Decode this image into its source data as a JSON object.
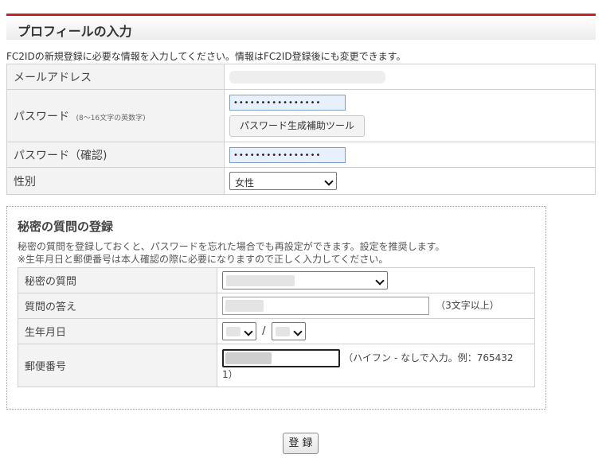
{
  "header": {
    "title": "プロフィールの入力"
  },
  "intro_text": "FC2IDの新規登録に必要な情報を入力してください。情報はFC2ID登録後にも変更できます。",
  "form": {
    "email_label": "メールアドレス",
    "password_label": "パスワード",
    "password_hint": "(8〜16文字の英数字)",
    "password_value": "••••••••••••••••",
    "password_tool_button": "パスワード生成補助ツール",
    "password_confirm_label": "パスワード（確認)",
    "password_confirm_value": "••••••••••••••••",
    "gender_label": "性別",
    "gender_selected": "女性"
  },
  "secret": {
    "title": "秘密の質問の登録",
    "desc_line1": "秘密の質問を登録しておくと、パスワードを忘れた場合でも再設定ができます。設定を推奨します。",
    "desc_line2": "※生年月日と郵便番号は本人確認の際に必要になりますので正しく入力してください。",
    "question_label": "秘密の質問",
    "answer_label": "質問の答え",
    "answer_note": "（3文字以上）",
    "birthdate_label": "生年月日",
    "birthdate_separator": "/",
    "postal_label": "郵便番号",
    "postal_note_line1": "（ハイフン - なしで入力。例：765432",
    "postal_note_line2": "1）"
  },
  "submit_label": "登 録"
}
